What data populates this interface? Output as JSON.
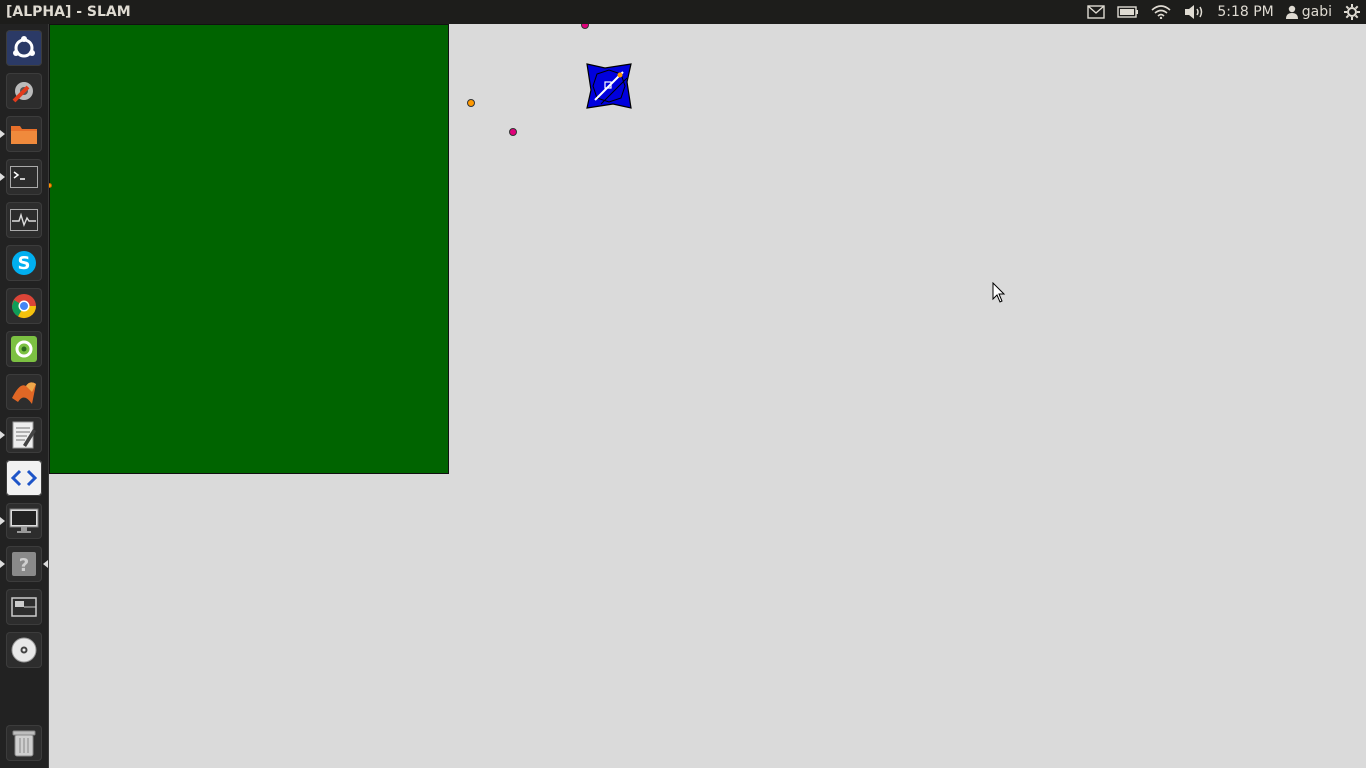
{
  "window": {
    "title": "[ALPHA] - SLAM"
  },
  "tray": {
    "mail_icon": "mail-icon",
    "battery_icon": "battery-icon",
    "wifi_icon": "wifi-icon",
    "volume_icon": "volume-icon",
    "clock": "5:18 PM",
    "user_icon": "user-icon",
    "user_name": "gabi",
    "power_icon": "power-gear-icon"
  },
  "launcher": {
    "items": [
      {
        "name": "dash-home",
        "icon": "ubuntu-logo-icon"
      },
      {
        "name": "system-settings",
        "icon": "settings-wrench-icon"
      },
      {
        "name": "files",
        "icon": "folder-icon"
      },
      {
        "name": "terminal",
        "icon": "terminal-icon"
      },
      {
        "name": "system-monitor",
        "icon": "activity-monitor-icon"
      },
      {
        "name": "skype",
        "icon": "skype-icon"
      },
      {
        "name": "chrome",
        "icon": "chrome-icon"
      },
      {
        "name": "app-green",
        "icon": "green-app-icon"
      },
      {
        "name": "matlab",
        "icon": "matlab-icon"
      },
      {
        "name": "text-editor",
        "icon": "text-editor-icon"
      },
      {
        "name": "code-editor",
        "icon": "code-brackets-icon"
      },
      {
        "name": "display",
        "icon": "monitor-icon"
      },
      {
        "name": "unknown-app",
        "icon": "question-mark-icon"
      },
      {
        "name": "workspace-switcher",
        "icon": "workspace-icon"
      },
      {
        "name": "optical-drive",
        "icon": "disc-icon"
      },
      {
        "name": "trash",
        "icon": "trash-icon"
      }
    ]
  },
  "scene": {
    "panel_color": "#006400",
    "background_color": "#dadada",
    "robot_color": "#0000dd",
    "landmark_colors": {
      "orange": "#ff9900",
      "magenta": "#e0007a"
    }
  }
}
